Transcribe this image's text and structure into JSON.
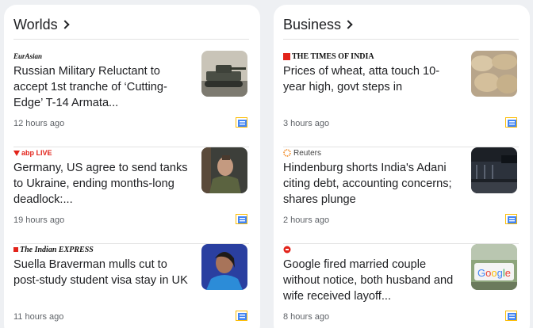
{
  "world": {
    "title": "Worlds",
    "articles": [
      {
        "source": "EurAsian",
        "headline": "Russian Military Reluctant to accept 1st tranche of ‘Cutting-Edge’ T-14 Armata...",
        "time": "12 hours ago"
      },
      {
        "source": "abp LIVE",
        "headline": "Germany, US agree to send tanks to Ukraine, ending months-long deadlock:...",
        "time": "19 hours ago"
      },
      {
        "source": "The Indian EXPRESS",
        "headline": "Suella Braverman mulls cut to post-study student visa stay in UK",
        "time": "11 hours ago"
      }
    ]
  },
  "business": {
    "title": "Business",
    "articles": [
      {
        "source": "THE TIMES OF INDIA",
        "headline": "Prices of wheat, atta touch 10-year high, govt steps in",
        "time": "3 hours ago"
      },
      {
        "source": "Reuters",
        "headline": "Hindenburg shorts India's Adani citing debt, accounting concerns; shares plunge",
        "time": "2 hours ago"
      },
      {
        "source": "",
        "headline": "Google fired married couple without notice, both husband and wife received layoff...",
        "time": "8 hours ago"
      }
    ]
  },
  "colors": {
    "accent_red": "#e2231a",
    "story_icon_blue": "#4285f4",
    "story_icon_yellow": "#fbbc04"
  },
  "icons": {
    "full_coverage": "full-coverage-icon",
    "chevron": "chevron-right-icon"
  }
}
